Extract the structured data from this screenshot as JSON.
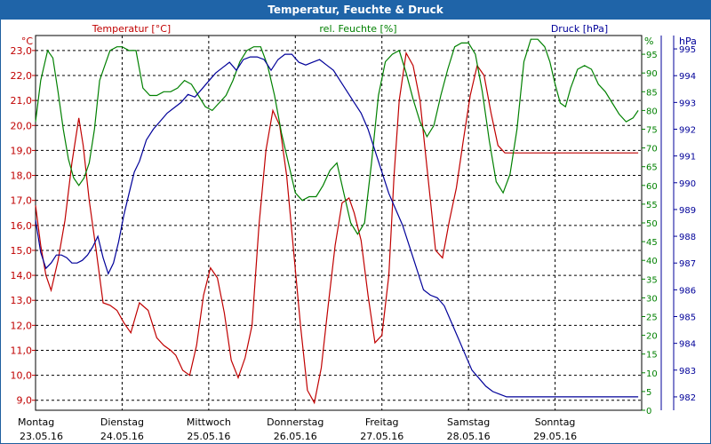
{
  "window": {
    "title": "Temperatur, Feuchte & Druck"
  },
  "chart_data": {
    "type": "line",
    "title": "Temperatur, Feuchte & Druck",
    "axes": {
      "temperature": {
        "label": "Temperatur [°C]",
        "unit": "°C",
        "range": [
          8.6,
          23.6
        ],
        "ticks": [
          "9,0",
          "10,0",
          "11,0",
          "12,0",
          "13,0",
          "14,0",
          "15,0",
          "16,0",
          "17,0",
          "18,0",
          "19,0",
          "20,0",
          "21,0",
          "22,0",
          "23,0"
        ],
        "color": "#c00000"
      },
      "humidity": {
        "label": "rel. Feuchte [%]",
        "unit": "%",
        "range": [
          0,
          100
        ],
        "ticks": [
          "0",
          "5",
          "10",
          "15",
          "20",
          "25",
          "30",
          "35",
          "40",
          "45",
          "50",
          "55",
          "60",
          "65",
          "70",
          "75",
          "80",
          "85",
          "90",
          "95"
        ],
        "color": "#008000"
      },
      "pressure": {
        "label": "Druck [hPa]",
        "unit": "hPa",
        "range": [
          981.5,
          995.5
        ],
        "ticks": [
          "982",
          "983",
          "984",
          "985",
          "986",
          "987",
          "988",
          "989",
          "990",
          "991",
          "992",
          "993",
          "994",
          "995"
        ],
        "color": "#000099"
      }
    },
    "x_axis": {
      "days": [
        {
          "name": "Montag",
          "date": "23.05.16"
        },
        {
          "name": "Dienstag",
          "date": "24.05.16"
        },
        {
          "name": "Mittwoch",
          "date": "25.05.16"
        },
        {
          "name": "Donnerstag",
          "date": "26.05.16"
        },
        {
          "name": "Freitag",
          "date": "27.05.16"
        },
        {
          "name": "Samstag",
          "date": "28.05.16"
        },
        {
          "name": "Sonntag",
          "date": "29.05.16"
        }
      ],
      "range": [
        0,
        7
      ]
    },
    "grid": true,
    "series": [
      {
        "name": "Temperatur [°C]",
        "axis": "temperature",
        "color": "#c00000",
        "x": [
          0,
          0.06,
          0.12,
          0.18,
          0.26,
          0.34,
          0.42,
          0.5,
          0.55,
          0.62,
          0.7,
          0.78,
          0.86,
          0.94,
          1.02,
          1.1,
          1.2,
          1.3,
          1.4,
          1.48,
          1.56,
          1.62,
          1.7,
          1.78,
          1.86,
          1.94,
          2.02,
          2.1,
          2.18,
          2.26,
          2.34,
          2.42,
          2.5,
          2.58,
          2.66,
          2.74,
          2.82,
          2.9,
          2.98,
          3.06,
          3.14,
          3.22,
          3.3,
          3.38,
          3.46,
          3.54,
          3.62,
          3.68,
          3.76,
          3.84,
          3.92,
          4.0,
          4.08,
          4.14,
          4.2,
          4.28,
          4.36,
          4.44,
          4.5,
          4.56,
          4.62,
          4.7,
          4.78,
          4.86,
          4.94,
          5.02,
          5.1,
          5.18,
          5.26,
          5.34,
          5.42,
          5.5,
          5.58,
          5.64,
          5.7,
          5.76,
          5.82,
          5.88,
          5.94,
          6.0,
          6.06,
          6.12,
          6.18,
          6.26,
          6.34,
          6.42,
          6.5,
          6.58,
          6.66,
          6.74,
          6.82,
          6.9,
          6.96
        ],
        "values": [
          16.8,
          15.2,
          14.0,
          13.4,
          14.6,
          16.2,
          18.5,
          20.3,
          19.2,
          17.0,
          15.0,
          12.9,
          12.8,
          12.6,
          12.1,
          11.7,
          12.9,
          12.6,
          11.5,
          11.2,
          11.0,
          10.8,
          10.2,
          10.0,
          11.2,
          13.2,
          14.3,
          13.9,
          12.5,
          10.6,
          9.9,
          10.7,
          12.0,
          16.0,
          19.0,
          20.6,
          20.0,
          18.0,
          15.0,
          12.0,
          9.4,
          8.9,
          10.3,
          12.8,
          15.2,
          16.9,
          17.1,
          16.5,
          15.4,
          13.2,
          11.3,
          11.6,
          14.0,
          18.0,
          21.0,
          22.9,
          22.4,
          21.0,
          19.0,
          17.0,
          15.0,
          14.7,
          16.2,
          17.5,
          19.4,
          21.2,
          22.4,
          22.0,
          20.5,
          19.2,
          18.9,
          18.9,
          18.9,
          18.9,
          18.9,
          18.9,
          18.9,
          18.9,
          18.9,
          18.9,
          18.9,
          18.9,
          18.9,
          18.9,
          18.9,
          18.9,
          18.9,
          18.9,
          18.9,
          18.9,
          18.9,
          18.9,
          18.9
        ]
      },
      {
        "name": "rel. Feuchte [%]",
        "axis": "humidity",
        "color": "#008000",
        "x": [
          0,
          0.06,
          0.14,
          0.2,
          0.26,
          0.32,
          0.38,
          0.44,
          0.5,
          0.56,
          0.62,
          0.68,
          0.74,
          0.8,
          0.86,
          0.94,
          1.0,
          1.08,
          1.16,
          1.24,
          1.32,
          1.4,
          1.48,
          1.56,
          1.64,
          1.72,
          1.8,
          1.88,
          1.96,
          2.04,
          2.12,
          2.2,
          2.28,
          2.36,
          2.44,
          2.52,
          2.6,
          2.68,
          2.76,
          2.84,
          2.92,
          3.0,
          3.08,
          3.16,
          3.24,
          3.32,
          3.4,
          3.48,
          3.56,
          3.64,
          3.72,
          3.8,
          3.88,
          3.96,
          4.04,
          4.12,
          4.2,
          4.28,
          4.36,
          4.44,
          4.52,
          4.6,
          4.68,
          4.76,
          4.84,
          4.92,
          5.0,
          5.08,
          5.16,
          5.24,
          5.32,
          5.4,
          5.48,
          5.56,
          5.64,
          5.72,
          5.8,
          5.88,
          5.94,
          6.0,
          6.06,
          6.12,
          6.18,
          6.26,
          6.34,
          6.42,
          6.5,
          6.58,
          6.66,
          6.74,
          6.82,
          6.9,
          6.96
        ],
        "values": [
          77,
          88,
          96,
          94,
          85,
          75,
          67,
          62,
          60,
          62,
          66,
          75,
          88,
          92,
          96,
          97,
          97,
          96,
          96,
          86,
          84,
          84,
          85,
          85,
          86,
          88,
          87,
          84,
          81,
          80,
          82,
          84,
          88,
          93,
          96,
          97,
          97,
          92,
          84,
          74,
          66,
          58,
          56,
          57,
          57,
          60,
          64,
          66,
          58,
          50,
          47,
          50,
          66,
          84,
          93,
          95,
          96,
          90,
          83,
          77,
          73,
          76,
          84,
          91,
          97,
          98,
          98,
          95,
          85,
          72,
          61,
          58,
          63,
          75,
          93,
          99,
          99,
          97,
          93,
          87,
          82,
          81,
          86,
          91,
          92,
          91,
          87,
          85,
          82,
          79,
          77,
          78,
          80
        ]
      },
      {
        "name": "Druck [hPa]",
        "axis": "pressure",
        "color": "#000099",
        "x": [
          0,
          0.06,
          0.12,
          0.18,
          0.24,
          0.3,
          0.36,
          0.42,
          0.48,
          0.54,
          0.6,
          0.66,
          0.72,
          0.78,
          0.84,
          0.9,
          0.96,
          1.02,
          1.08,
          1.14,
          1.2,
          1.28,
          1.36,
          1.44,
          1.52,
          1.6,
          1.68,
          1.76,
          1.84,
          1.92,
          2.0,
          2.08,
          2.16,
          2.24,
          2.32,
          2.4,
          2.48,
          2.56,
          2.64,
          2.72,
          2.8,
          2.88,
          2.96,
          3.04,
          3.12,
          3.2,
          3.28,
          3.36,
          3.44,
          3.52,
          3.6,
          3.68,
          3.76,
          3.84,
          3.92,
          4.0,
          4.08,
          4.16,
          4.24,
          4.32,
          4.4,
          4.48,
          4.56,
          4.64,
          4.72,
          4.8,
          4.88,
          4.96,
          5.04,
          5.12,
          5.2,
          5.28,
          5.36,
          5.44,
          5.52,
          5.6,
          5.68,
          5.76,
          5.84,
          5.92,
          6.0,
          6.08,
          6.16,
          6.24,
          6.32,
          6.4,
          6.48,
          6.56,
          6.64,
          6.72,
          6.8,
          6.88,
          6.96
        ],
        "values": [
          988.6,
          987.4,
          986.8,
          987.0,
          987.3,
          987.3,
          987.2,
          987.0,
          987.0,
          987.1,
          987.3,
          987.6,
          988.0,
          987.2,
          986.6,
          987.0,
          987.8,
          988.8,
          989.6,
          990.4,
          990.8,
          991.6,
          992.0,
          992.3,
          992.6,
          992.8,
          993.0,
          993.3,
          993.2,
          993.5,
          993.8,
          994.1,
          994.3,
          994.5,
          994.2,
          994.6,
          994.7,
          994.7,
          994.6,
          994.2,
          994.6,
          994.8,
          994.8,
          994.5,
          994.4,
          994.5,
          994.6,
          994.4,
          994.2,
          993.8,
          993.4,
          993.0,
          992.6,
          992.0,
          991.2,
          990.4,
          989.6,
          989.0,
          988.4,
          987.6,
          986.8,
          986.0,
          985.8,
          985.7,
          985.4,
          984.8,
          984.2,
          983.6,
          983.0,
          982.7,
          982.4,
          982.2,
          982.1,
          982.0,
          982.0,
          982.0,
          982.0,
          982.0,
          982.0,
          982.0,
          982.0,
          982.0,
          982.0,
          982.0,
          982.0,
          982.0,
          982.0,
          982.0,
          982.0,
          982.0,
          982.0,
          982.0,
          982.0
        ]
      }
    ]
  }
}
